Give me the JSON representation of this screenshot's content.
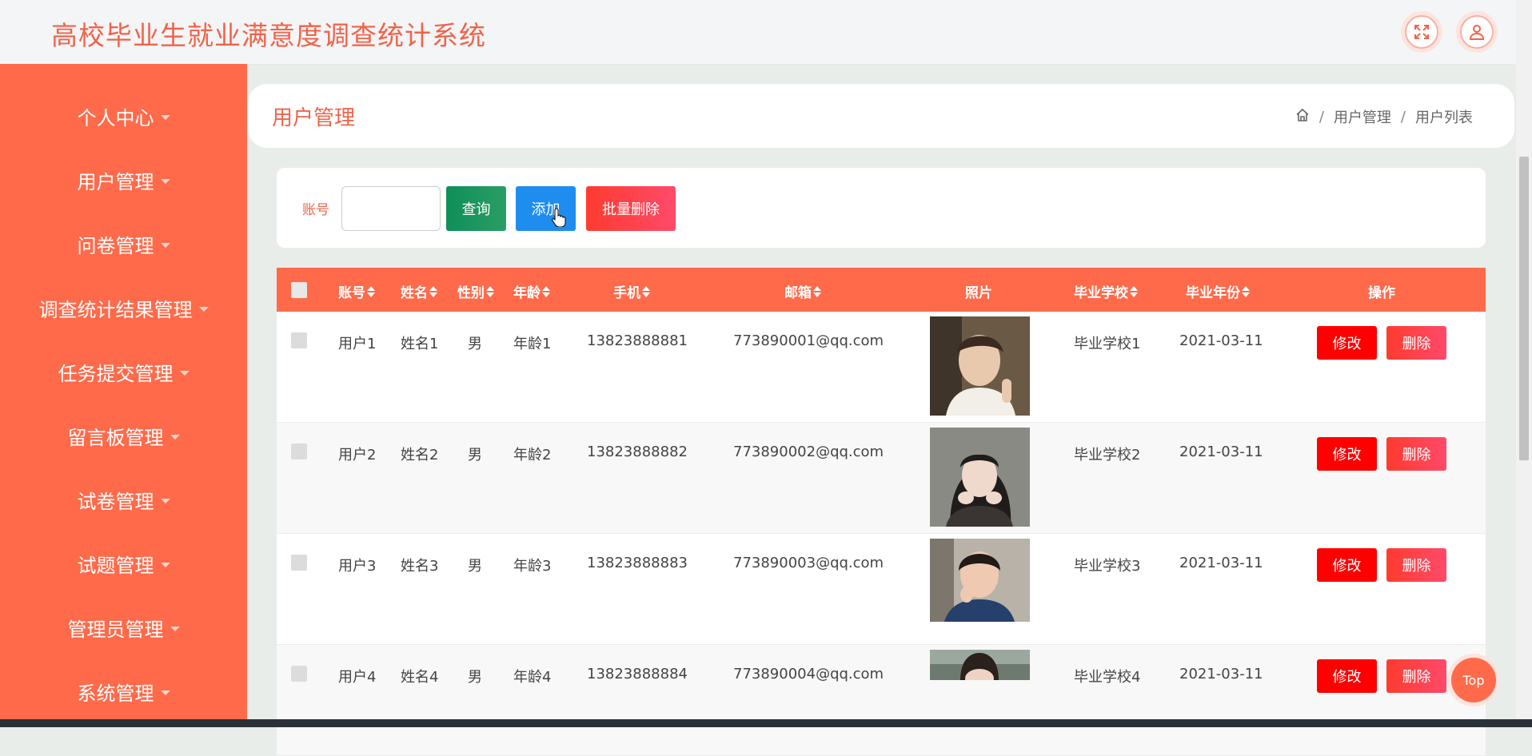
{
  "app": {
    "title": "高校毕业生就业满意度调查统计系统",
    "accent": "#ff6a4a"
  },
  "topbar": {
    "icons": [
      "fullscreen-icon",
      "user-icon"
    ]
  },
  "sidebar": {
    "items": [
      {
        "label": "个人中心"
      },
      {
        "label": "用户管理"
      },
      {
        "label": "问卷管理"
      },
      {
        "label": "调查统计结果管理"
      },
      {
        "label": "任务提交管理"
      },
      {
        "label": "留言板管理"
      },
      {
        "label": "试卷管理"
      },
      {
        "label": "试题管理"
      },
      {
        "label": "管理员管理"
      },
      {
        "label": "系统管理"
      }
    ]
  },
  "header": {
    "title": "用户管理",
    "breadcrumb": [
      "用户管理",
      "用户列表"
    ]
  },
  "search": {
    "label": "账号",
    "value": "",
    "query_label": "查询",
    "add_label": "添加",
    "batch_delete_label": "批量删除"
  },
  "table": {
    "columns": [
      "账号",
      "姓名",
      "性别",
      "年龄",
      "手机",
      "邮箱",
      "照片",
      "毕业学校",
      "毕业年份",
      "操作"
    ],
    "rows": [
      {
        "account": "用户1",
        "name": "姓名1",
        "gender": "男",
        "age": "年龄1",
        "phone": "13823888881",
        "email": "773890001@qq.com",
        "school": "毕业学校1",
        "year": "2021-03-11"
      },
      {
        "account": "用户2",
        "name": "姓名2",
        "gender": "男",
        "age": "年龄2",
        "phone": "13823888882",
        "email": "773890002@qq.com",
        "school": "毕业学校2",
        "year": "2021-03-11"
      },
      {
        "account": "用户3",
        "name": "姓名3",
        "gender": "男",
        "age": "年龄3",
        "phone": "13823888883",
        "email": "773890003@qq.com",
        "school": "毕业学校3",
        "year": "2021-03-11"
      },
      {
        "account": "用户4",
        "name": "姓名4",
        "gender": "男",
        "age": "年龄4",
        "phone": "13823888884",
        "email": "773890004@qq.com",
        "school": "毕业学校4",
        "year": "2021-03-11"
      }
    ],
    "edit_label": "修改",
    "delete_label": "删除"
  },
  "top_button": {
    "label": "Top"
  }
}
